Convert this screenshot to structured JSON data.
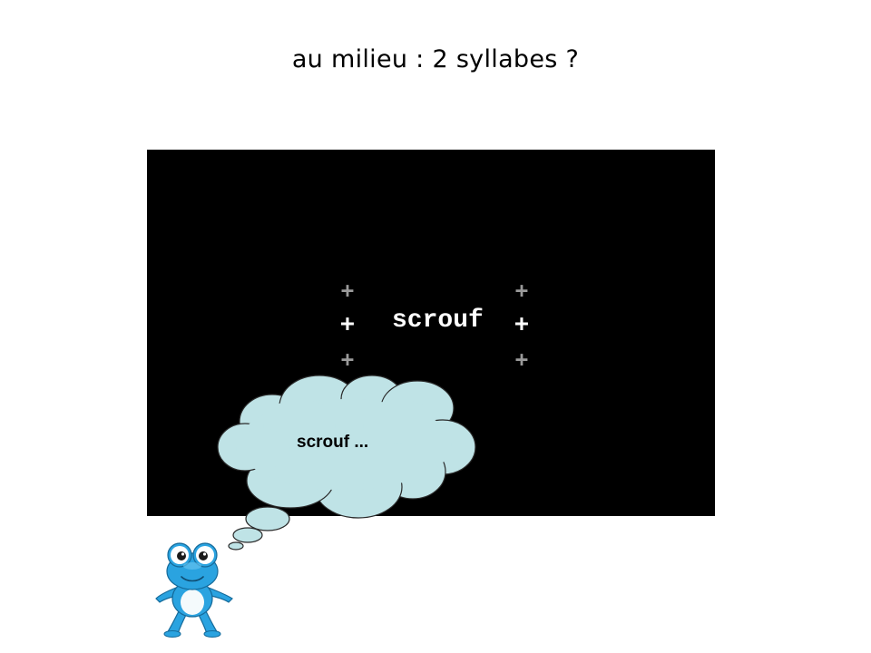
{
  "slide": {
    "title": "au milieu : 2 syllabes ?"
  },
  "stage": {
    "background": "#000000",
    "center_word": "scrouf",
    "fixation_marks": [
      "+",
      "+",
      "+",
      "+",
      "+",
      "+"
    ]
  },
  "thought_bubble": {
    "text": "scrouf ...",
    "fill_color": "#bfe3e6",
    "outline_color": "#2a2a2a"
  },
  "mascot": {
    "icon": "frog-mascot-icon",
    "body_color": "#2aa3e0"
  }
}
